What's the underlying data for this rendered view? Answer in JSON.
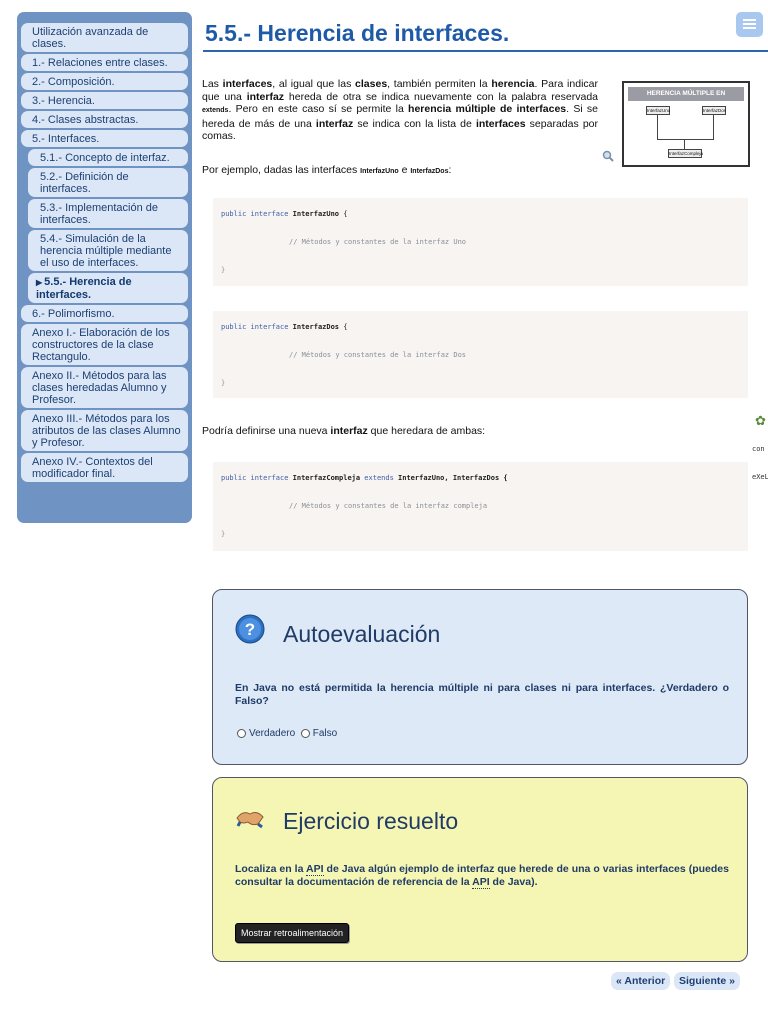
{
  "sidebar": {
    "items": [
      {
        "label": "Utilización avanzada de clases.",
        "level": 0
      },
      {
        "label": "1.- Relaciones entre clases.",
        "level": 0
      },
      {
        "label": "2.- Composición.",
        "level": 0
      },
      {
        "label": "3.- Herencia.",
        "level": 0
      },
      {
        "label": "4.- Clases abstractas.",
        "level": 0
      },
      {
        "label": "5.- Interfaces.",
        "level": 0
      },
      {
        "label": "5.1.- Concepto de interfaz.",
        "level": 1
      },
      {
        "label": "5.2.- Definición de interfaces.",
        "level": 1
      },
      {
        "label": "5.3.- Implementación de interfaces.",
        "level": 1
      },
      {
        "label": "5.4.- Simulación de la herencia múltiple mediante el uso de interfaces.",
        "level": 1
      },
      {
        "label": "5.5.- Herencia de interfaces.",
        "level": 1,
        "active": true
      },
      {
        "label": "6.- Polimorfismo.",
        "level": 0
      },
      {
        "label": "Anexo I.- Elaboración de los constructores de la clase Rectangulo.",
        "level": 0
      },
      {
        "label": "Anexo II.- Métodos para las clases heredadas Alumno y Profesor.",
        "level": 0
      },
      {
        "label": "Anexo III.- Métodos para los atributos de las clases Alumno y Profesor.",
        "level": 0
      },
      {
        "label": "Anexo IV.- Contextos del modificador final.",
        "level": 0
      }
    ]
  },
  "page": {
    "title": "5.5.- Herencia de interfaces.",
    "intro": {
      "t1": "Las ",
      "b1": "interfaces",
      "t2": ", al igual que las ",
      "b2": "clases",
      "t3": ", también permiten la ",
      "b3": "herencia",
      "t4": ". Para indicar que una ",
      "b4": "interfaz",
      "t5": " hereda de otra se indica nuevamente con la palabra reservada ",
      "kw": "extends",
      "t6": ". Pero en este caso sí se permite la ",
      "b5": "herencia múltiple de interfaces",
      "t7": ". Si se hereda de más de una ",
      "b6": "interfaz",
      "t8": " se indica con la lista de ",
      "b7": "interfaces",
      "t9": " separadas por comas."
    },
    "example_intro": {
      "t1": "Por ejemplo, dadas las interfaces ",
      "c1": "InterfazUno",
      "t2": " e ",
      "c2": "InterfazDos",
      "t3": ":"
    },
    "figure": {
      "heading": "HERENCIA MÚLTIPLE EN INTERFACES",
      "box_left": "InterfazUno",
      "box_right": "InterfazDos",
      "box_bottom": "InterfazCompleja"
    },
    "code_blocks": [
      {
        "keywords": "public interface ",
        "name": "InterfazUno",
        "rest": " {",
        "comment": "// Métodos y constantes de la interfaz Uno",
        "close": "}"
      },
      {
        "keywords": "public interface ",
        "name": "InterfazDos",
        "rest": " {",
        "comment": "// Métodos y constantes de la interfaz Dos",
        "close": "}"
      },
      {
        "keywords": "public interface ",
        "name": "InterfazCompleja",
        "ext": " extends ",
        "rest": "InterfazUno, InterfazDos {",
        "comment": "// Métodos y constantes de la interfaz compleja",
        "close": "}"
      }
    ],
    "middle": {
      "t1": "Podría definirse una nueva ",
      "b1": "interfaz",
      "t2": " que heredara de ambas:"
    },
    "side_fragments": [
      "con",
      "eXeL"
    ]
  },
  "self_assessment": {
    "title": "Autoevaluación",
    "question": "En Java no está permitida la herencia múltiple ni para clases ni para interfaces. ¿Verdadero o Falso?",
    "options": [
      "Verdadero",
      "Falso"
    ]
  },
  "exercise": {
    "title": "Ejercicio resuelto",
    "t1": "Localiza en la ",
    "api1": "API",
    "t2": " de Java algún ejemplo de interfaz que herede de una o varias interfaces (puedes consultar la documentación de referencia de la ",
    "api2": "API",
    "t3": " de Java).",
    "button": "Mostrar retroalimentación"
  },
  "pager": {
    "prev": "« Anterior",
    "next": "Siguiente »"
  },
  "colors": {
    "sidebar_bg": "#6f93c2",
    "nav_item_bg": "#dbe7f6",
    "title_blue": "#1f5aa8",
    "assessment_bg": "#dde9f7",
    "exercise_bg": "#f6f6b4"
  },
  "icons": [
    "menu-icon",
    "magnifier-icon",
    "question-icon",
    "handshake-icon",
    "exe-logo-icon"
  ]
}
